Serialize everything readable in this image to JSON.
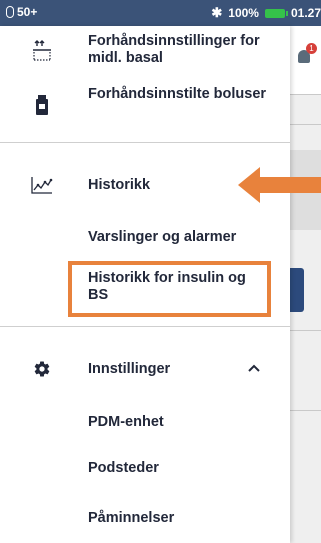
{
  "status_bar": {
    "pod_level": "50+",
    "battery_percent": "100%",
    "time": "01.27",
    "battery_color": "#35c24a",
    "bar_color": "#3b5378"
  },
  "background": {
    "notification_badge": "1"
  },
  "drawer": {
    "items": [
      {
        "label": "Forhåndsinnstillinger for midl. basal",
        "icon": "temp-basal-icon"
      },
      {
        "label": "Forhåndsinnstilte boluser",
        "icon": "bolus-vial-icon"
      },
      {
        "label": "Historikk",
        "icon": "history-chart-icon"
      },
      {
        "label": "Varslinger og alarmer"
      },
      {
        "label": "Historikk for insulin og BS"
      },
      {
        "label": "Innstillinger",
        "icon": "gear-icon",
        "expanded": true
      },
      {
        "label": "PDM-enhet"
      },
      {
        "label": "Podsteder"
      },
      {
        "label": "Påminnelser"
      }
    ]
  },
  "annotation": {
    "highlight_color": "#e8823c",
    "arrow_color": "#e8823c"
  }
}
